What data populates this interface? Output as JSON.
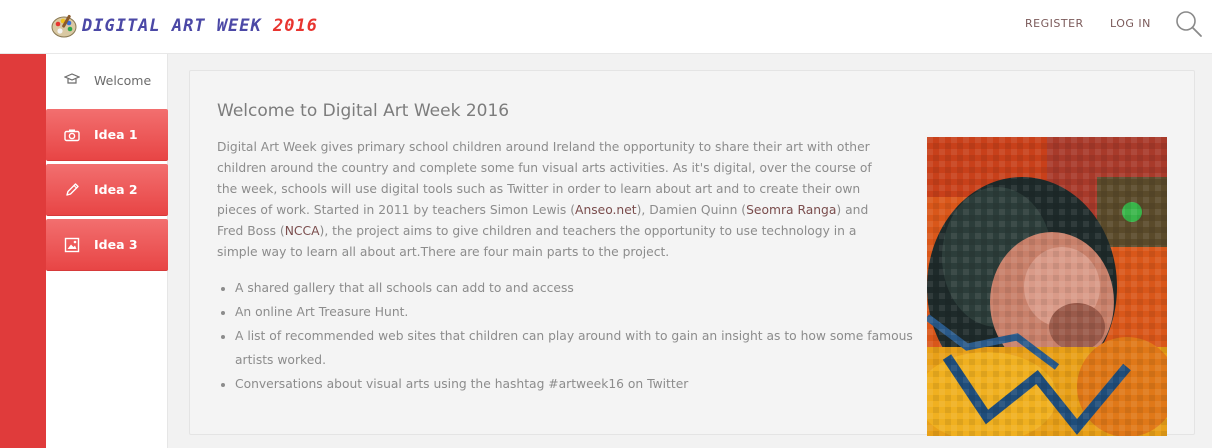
{
  "header": {
    "logo_text": "DIGITAL ART WEEK ",
    "logo_year": "2016",
    "nav": {
      "register": "REGISTER",
      "login": "LOG IN"
    },
    "search_icon": "search-icon"
  },
  "sidebar": {
    "items": [
      {
        "label": "Welcome",
        "icon": "mortarboard-icon"
      },
      {
        "label": "Idea 1",
        "icon": "camera-icon"
      },
      {
        "label": "Idea 2",
        "icon": "pencil-icon"
      },
      {
        "label": "Idea 3",
        "icon": "picture-icon"
      }
    ]
  },
  "main": {
    "title": "Welcome to Digital Art Week 2016",
    "intro_1": "Digital Art Week gives primary school children around Ireland the opportunity to share their art with other children around the country and complete some fun visual arts activities. As it's digital, over the course of the week, schools will use digital tools such as Twitter in order to learn about art and to create their own pieces of work. Started in 2011 by teachers Simon Lewis (",
    "link_anseo": "Anseo.net",
    "intro_2": "), Damien Quinn (",
    "link_seomra": "Seomra Ranga",
    "intro_3": ") and Fred Boss (",
    "link_ncca": "NCCA",
    "intro_4": "), the project aims to give children and teachers the opportunity to use technology in a simple way to learn all about art.There are four main parts to the project.",
    "bullets": [
      "A shared gallery that all schools can add to and access",
      "An online Art Treasure Hunt.",
      "A list of recommended web sites that children can play around with to gain an insight as to how some famous artists worked.",
      "Conversations about visual arts using the hashtag #artweek16 on Twitter"
    ]
  },
  "colors": {
    "accent_red": "#e84545",
    "logo_blue": "#4b48a6",
    "logo_red": "#e8342f"
  }
}
